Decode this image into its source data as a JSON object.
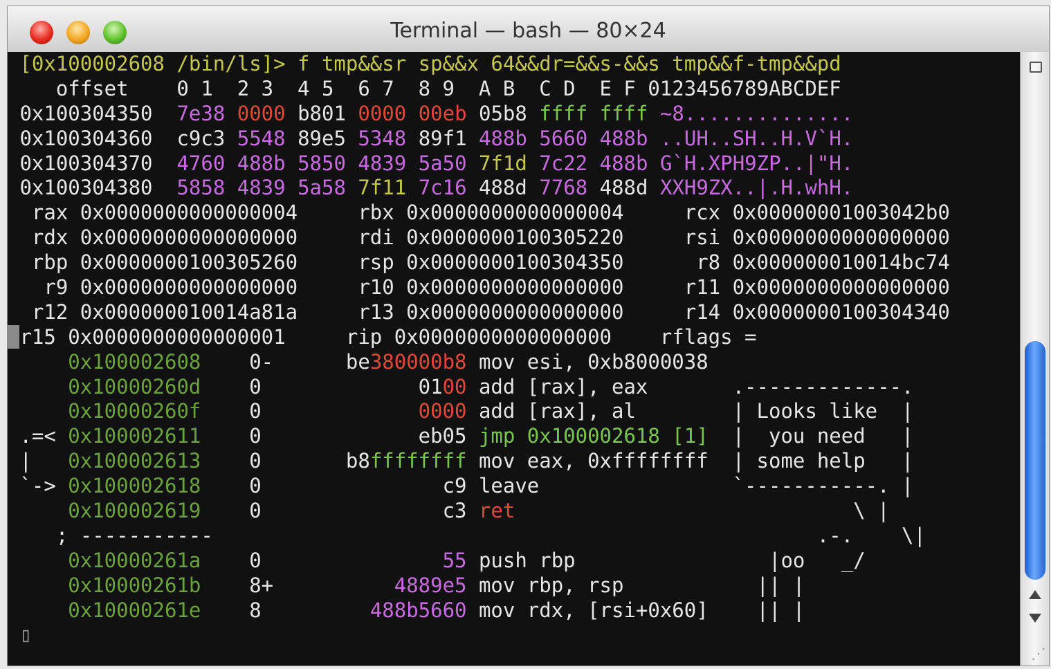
{
  "window": {
    "title": "Terminal — bash — 80×24"
  },
  "terminal": {
    "prompt": "[0x100002608 /bin/ls]>",
    "command": " f tmp&&sr sp&&x 64&&dr=&&s-&&s tmp&&f-tmp&&pd",
    "hex_header": "   offset    0 1  2 3  4 5  6 7  8 9  A B  C D  E F 0123456789ABCDEF",
    "hex_rows": [
      {
        "addr": "0x100304350",
        "w": [
          "7e38",
          "0000",
          "b801",
          "0000",
          "00eb",
          "05b8",
          "ffff",
          "ffff"
        ],
        "ascii": "~8.............."
      },
      {
        "addr": "0x100304360",
        "w": [
          "c9c3",
          "5548",
          "89e5",
          "5348",
          "89f1",
          "488b",
          "5660",
          "488b"
        ],
        "ascii": "..UH..SH..H.V`H."
      },
      {
        "addr": "0x100304370",
        "w": [
          "4760",
          "488b",
          "5850",
          "4839",
          "5a50",
          "7f1d",
          "7c22",
          "488b"
        ],
        "ascii": "G`H.XPH9ZP..|\"H."
      },
      {
        "addr": "0x100304380",
        "w": [
          "5858",
          "4839",
          "5a58",
          "7f11",
          "7c16",
          "488d",
          "7768",
          "488d"
        ],
        "ascii": "XXH9ZX..|.H.whH."
      }
    ],
    "registers": [
      " rax 0x0000000000000004     rbx 0x0000000000000004     rcx 0x00000001003042b0",
      " rdx 0x0000000000000000     rdi 0x0000000100305220     rsi 0x0000000000000000",
      " rbp 0x0000000100305260     rsp 0x0000000100304350      r8 0x000000010014bc74",
      "  r9 0x0000000000000000     r10 0x0000000000000000     r11 0x0000000000000000",
      " r12 0x000000010014a81a     r13 0x0000000000000000     r14 0x0000000100304340",
      "r15 0x0000000000000001     rip 0x0000000000000000    rflags ="
    ],
    "disasm": [
      {
        "pre": "    ",
        "addr": "0x100002608",
        "flag": "0-",
        "bytes_a": "be",
        "bytes_b": "380000b8",
        "op": "mov esi, 0xb8000038",
        "side": ""
      },
      {
        "pre": "    ",
        "addr": "0x10000260d",
        "flag": "0 ",
        "bytes_a": "01",
        "bytes_b": "00",
        "op": "add [rax], eax",
        "side": ""
      },
      {
        "pre": "    ",
        "addr": "0x10000260f",
        "flag": "0 ",
        "bytes_a": "",
        "bytes_b": "0000",
        "op": "add [rax], al",
        "side": ""
      },
      {
        "pre": " .=<",
        "addr": "0x100002611",
        "flag": "0 ",
        "bytes_a": "eb05",
        "bytes_b": "",
        "op": "jmp 0x100002618 [1]",
        "side": ""
      },
      {
        "pre": " |  ",
        "addr": "0x100002613",
        "flag": "0 ",
        "bytes_a": "b8",
        "bytes_b": "ffffffff",
        "op": "mov eax, 0xffffffff",
        "side": ""
      },
      {
        "pre": " `->",
        "addr": "0x100002618",
        "flag": "0 ",
        "bytes_a": "c9",
        "bytes_b": "",
        "op": "leave",
        "side": ""
      },
      {
        "pre": "    ",
        "addr": "0x100002619",
        "flag": "0 ",
        "bytes_a": "c3",
        "bytes_b": "",
        "op": "ret",
        "side": ""
      }
    ],
    "separator": "    ; -----------",
    "disasm2": [
      {
        "pre": "    ",
        "addr": "0x10000261a",
        "flag": "0 ",
        "bytes": "55",
        "op": "push rbp"
      },
      {
        "pre": "    ",
        "addr": "0x10000261b",
        "flag": "8+",
        "bytes": "4889e5",
        "op": "mov rbp, rsp"
      },
      {
        "pre": "    ",
        "addr": "0x10000261e",
        "flag": "8 ",
        "bytes": "488b5660",
        "op": "mov rdx, [rsi+0x60]"
      }
    ],
    "clippy": [
      ".-------------.",
      "| Looks like  |",
      "|  you need   |",
      "| some help   |",
      "`-----------. |",
      "          \\ |",
      "   .-.    \\|",
      "   |oo   _/",
      "  || |",
      "  || |",
      "  `'-'",
      "   __"
    ]
  }
}
